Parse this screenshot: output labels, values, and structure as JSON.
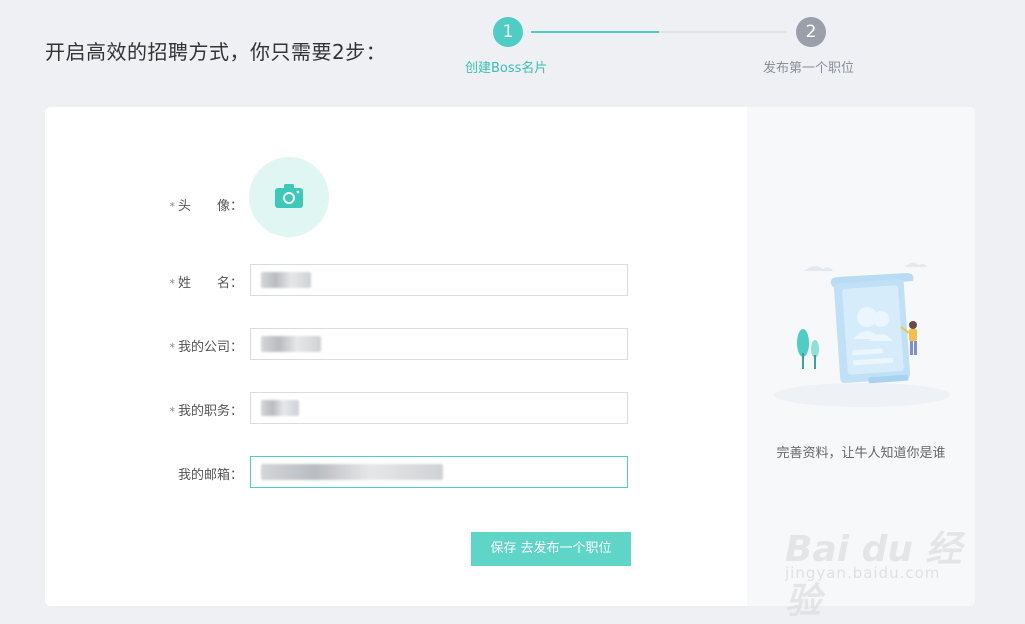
{
  "header": {
    "title": "开启高效的招聘方式，你只需要2步："
  },
  "steps": [
    {
      "number": "1",
      "label": "创建Boss名片",
      "status": "active"
    },
    {
      "number": "2",
      "label": "发布第一个职位",
      "status": "inactive"
    }
  ],
  "form": {
    "avatar_label": "头　　像：",
    "name_label": "姓　　名：",
    "company_label": "我的公司：",
    "position_label": "我的职务：",
    "email_label": "我的邮箱：",
    "required_mark": "*",
    "save_button": "保存 去发布一个职位"
  },
  "side_panel": {
    "caption": "完善资料，让牛人知道你是谁"
  },
  "watermark": {
    "brand": "Bai du 经验",
    "url": "jingyan.baidu.com"
  },
  "colors": {
    "accent": "#4ecdc4",
    "button": "#5ed5c6",
    "inactive_step": "#9aa0aa"
  }
}
